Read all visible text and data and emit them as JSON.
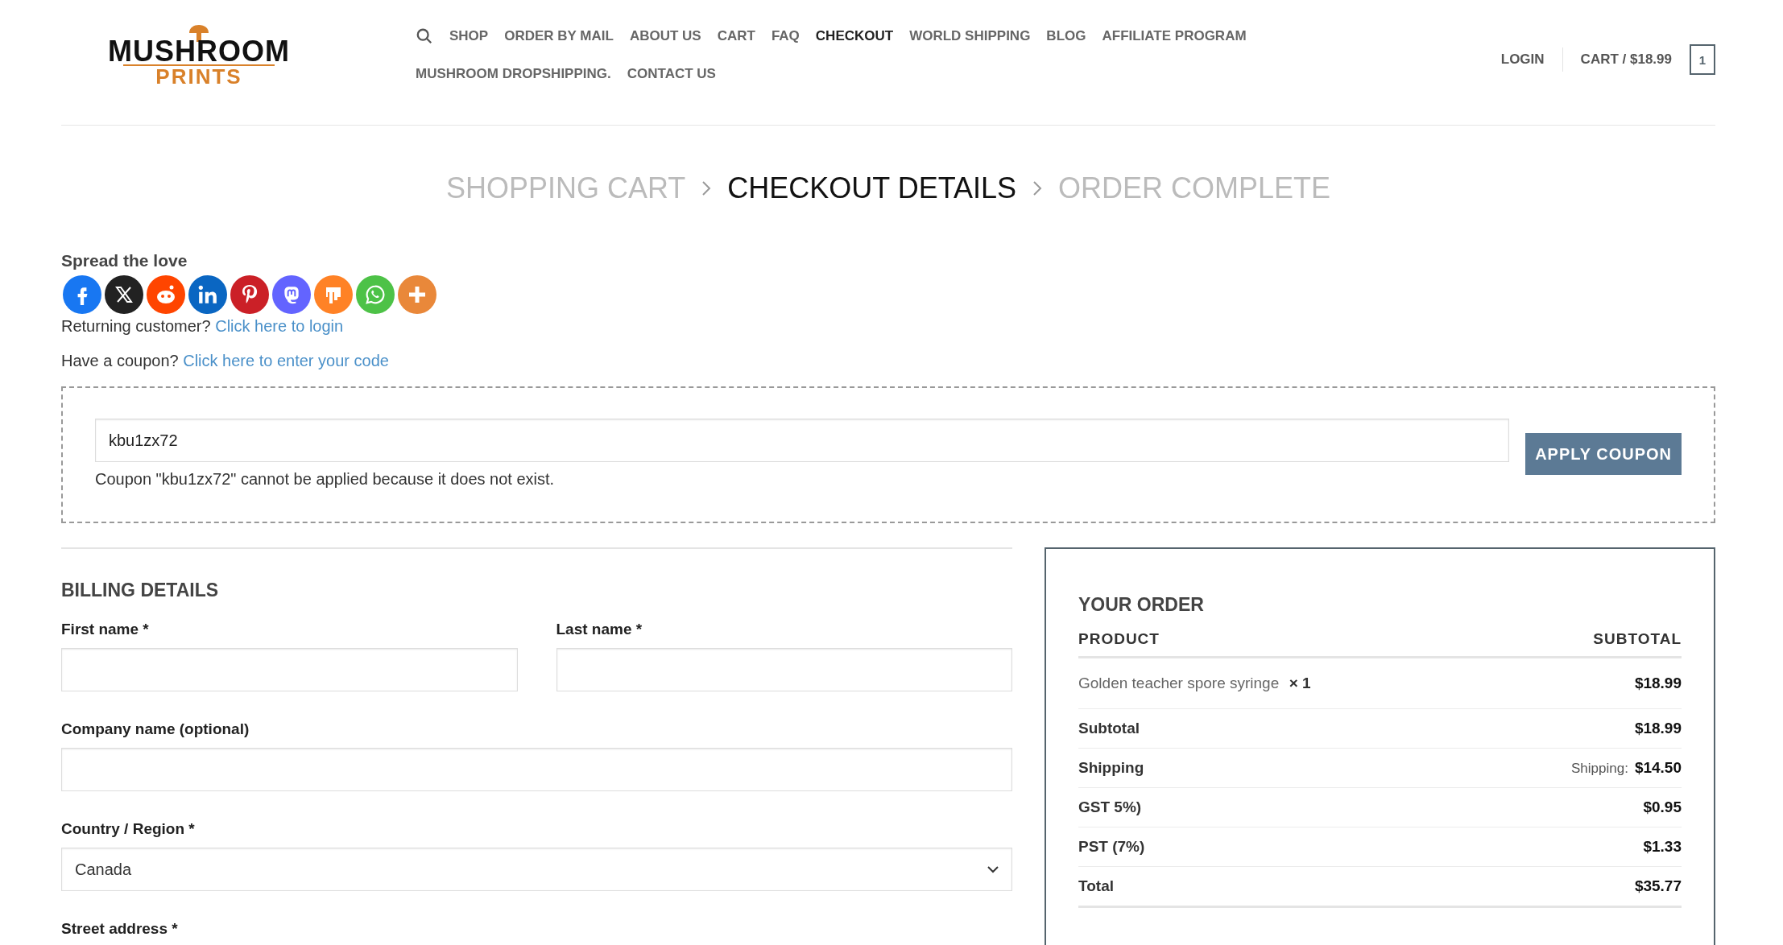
{
  "logo": {
    "line1": "MUSHROOM",
    "line2": "PRINTS"
  },
  "nav": [
    {
      "label": "SHOP",
      "selected": false
    },
    {
      "label": "ORDER BY MAIL",
      "selected": false
    },
    {
      "label": "ABOUT US",
      "selected": false
    },
    {
      "label": "CART",
      "selected": false
    },
    {
      "label": "FAQ",
      "selected": false
    },
    {
      "label": "CHECKOUT",
      "selected": true
    },
    {
      "label": "WORLD SHIPPING",
      "selected": false
    },
    {
      "label": "BLOG",
      "selected": false
    },
    {
      "label": "AFFILIATE PROGRAM",
      "selected": false
    },
    {
      "label": "MUSHROOM DROPSHIPPING.",
      "selected": false
    },
    {
      "label": "CONTACT US",
      "selected": false
    }
  ],
  "account": {
    "login": "LOGIN",
    "cart": "CART / $18.99",
    "cart_count": "1"
  },
  "steps": [
    {
      "label": "SHOPPING CART",
      "selected": false
    },
    {
      "label": "CHECKOUT DETAILS",
      "selected": true
    },
    {
      "label": "ORDER COMPLETE",
      "selected": false
    }
  ],
  "share": {
    "title": "Spread the love",
    "buttons": [
      {
        "kind": "facebook",
        "color": "#1877f2"
      },
      {
        "kind": "x",
        "color": "#222222"
      },
      {
        "kind": "reddit",
        "color": "#ff4500"
      },
      {
        "kind": "linkedin",
        "color": "#0a66c2"
      },
      {
        "kind": "pinterest",
        "color": "#cb2027"
      },
      {
        "kind": "mastodon",
        "color": "#6364ff"
      },
      {
        "kind": "mix",
        "color": "#ff8226"
      },
      {
        "kind": "whatsapp",
        "color": "#4dc247"
      },
      {
        "kind": "more",
        "color": "#e9883a"
      }
    ]
  },
  "notices": [
    {
      "text": "Returning customer?",
      "link": "Click here to login"
    },
    {
      "text": "Have a coupon?",
      "link": "Click here to enter your code"
    }
  ],
  "coupon": {
    "value": "kbu1zx72",
    "button": "APPLY COUPON",
    "error": "Coupon \"kbu1zx72\" cannot be applied because it does not exist."
  },
  "billing": {
    "title": "BILLING DETAILS",
    "first_name": "First name *",
    "last_name": "Last name *",
    "company": "Company name (optional)",
    "country_label": "Country / Region *",
    "country": "Canada",
    "street": "Street address *"
  },
  "order": {
    "title": "YOUR ORDER",
    "columns": [
      "PRODUCT",
      "SUBTOTAL"
    ],
    "item": {
      "name": "Golden teacher spore syringe",
      "qty": "× 1",
      "price": "$18.99"
    },
    "rows": [
      {
        "label": "Subtotal",
        "value": "$18.99"
      },
      {
        "label": "Shipping",
        "prefix": "Shipping:",
        "value": "$14.50"
      },
      {
        "label": "GST 5%)",
        "value": "$0.95"
      },
      {
        "label": "PST (7%)",
        "value": "$1.33"
      },
      {
        "label": "Total",
        "value": "$35.77"
      }
    ]
  }
}
